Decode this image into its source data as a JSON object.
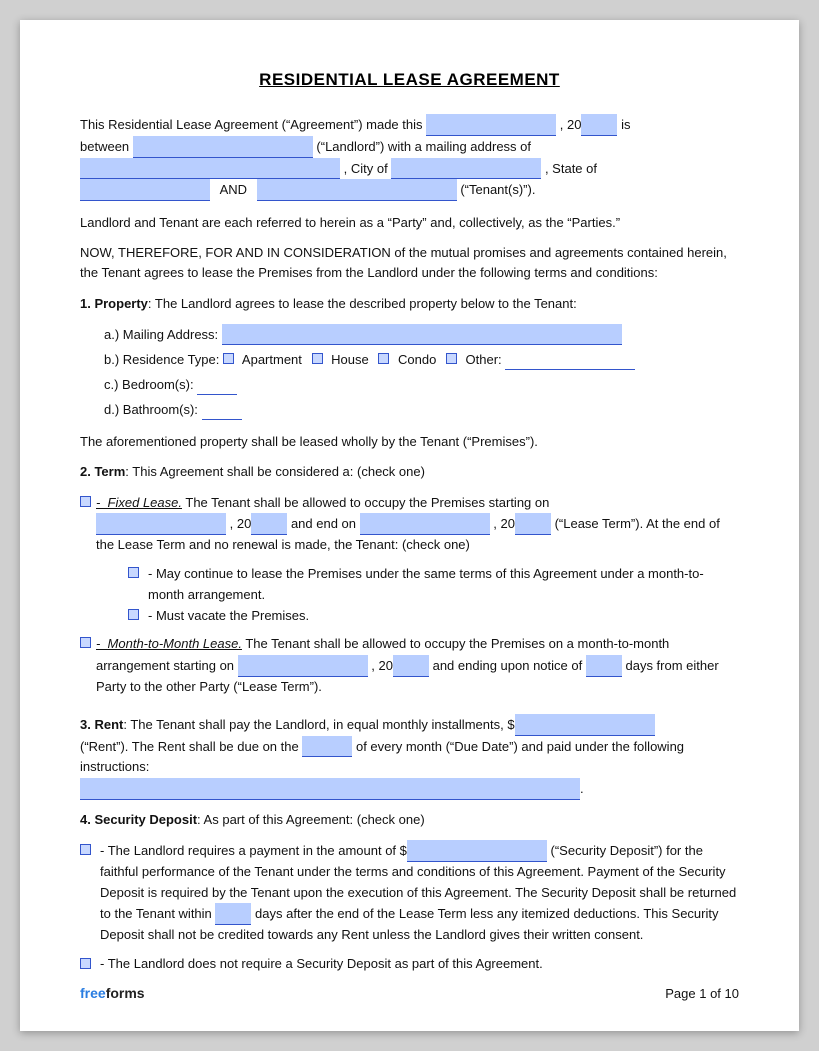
{
  "title": "RESIDENTIAL LEASE AGREEMENT",
  "intro": {
    "line1_pre": "This Residential Lease Agreement (“Agreement”) made this",
    "line1_day_field": "",
    "line1_mid": ", 20",
    "line1_year_field": "",
    "line1_post": "is",
    "line2_pre": "between",
    "line2_landlord_field": "",
    "line2_post": "(“Landlord”) with a mailing address of",
    "line3_address_field": "",
    "line3_mid": ", City of",
    "line3_city_field": "",
    "line3_post": ", State of",
    "line4_state_field": "",
    "line4_mid": "AND",
    "line4_tenant_field": "",
    "line4_post": "(“Tenant(s)”)."
  },
  "parties_note": "Landlord and Tenant are each referred to herein as a “Party” and, collectively, as the “Parties.”",
  "consideration": "NOW, THEREFORE, FOR AND IN CONSIDERATION of the mutual promises and agreements contained herein, the Tenant agrees to lease the Premises from the Landlord under the following terms and conditions:",
  "section1": {
    "header": "1. Property",
    "text": ": The Landlord agrees to lease the described property below to the Tenant:",
    "a_label": "a.)  Mailing Address:",
    "b_label": "b.)  Residence Type:",
    "b_apartment": "Apartment",
    "b_house": "House",
    "b_condo": "Condo",
    "b_other": "Other:",
    "c_label": "c.)  Bedroom(s):",
    "d_label": "d.)  Bathroom(s):",
    "premises_note": "The aforementioned property shall be leased wholly by the Tenant (“Premises”)."
  },
  "section2": {
    "header": "2. Term",
    "text": ": This Agreement shall be considered a: (check one)",
    "fixed_label": "-  Fixed Lease.",
    "fixed_text": " The Tenant shall be allowed to occupy the Premises starting on",
    "fixed_start_field": "",
    "fixed_start_year_pre": ", 20",
    "fixed_start_year_field": "",
    "fixed_mid": "and end on",
    "fixed_end_field": "",
    "fixed_end_year_pre": ", 20",
    "fixed_end_year_field": "",
    "fixed_post": "(“Lease Term”). At the end of the Lease Term and no renewal is made, the Tenant: (check one)",
    "option1_text": "- May continue to lease the Premises under the same terms of this Agreement under a month-to-month arrangement.",
    "option2_text": "- Must vacate the Premises.",
    "month_label": "-  Month-to-Month Lease.",
    "month_text": " The Tenant shall be allowed to occupy the Premises on a month-to-month arrangement starting on",
    "month_start_field": "",
    "month_year_pre": ", 20",
    "month_year_field": "",
    "month_mid": "and ending upon notice of",
    "month_days_field": "",
    "month_post": "days from either Party to the other Party (“Lease Term”)."
  },
  "section3": {
    "header": "3. Rent",
    "text": ": The Tenant shall pay the Landlord, in equal monthly installments, $",
    "rent_field": "",
    "rent_post": "(“Rent”). The Rent shall be due on the",
    "due_field": "",
    "due_post": "of every month (“Due Date”) and paid under the following instructions:",
    "instructions_field": "."
  },
  "section4": {
    "header": "4. Security Deposit",
    "text": ": As part of this Agreement: (check one)",
    "option1_pre": "- The Landlord requires a payment in the amount of $",
    "option1_amount_field": "",
    "option1_post": "(“Security Deposit”) for the faithful performance of the Tenant under the terms and conditions of this Agreement. Payment of the Security Deposit is required by the Tenant upon the execution of this Agreement. The Security Deposit shall be returned to the Tenant within",
    "option1_days_field": "",
    "option1_end": "days after the end of the Lease Term less any itemized deductions. This Security Deposit shall not be credited towards any Rent unless the Landlord gives their written consent.",
    "option2_text": "- The Landlord does not require a Security Deposit as part of this Agreement."
  },
  "footer": {
    "brand_free": "free",
    "brand_forms": "forms",
    "page_text": "Page 1 of 10"
  }
}
